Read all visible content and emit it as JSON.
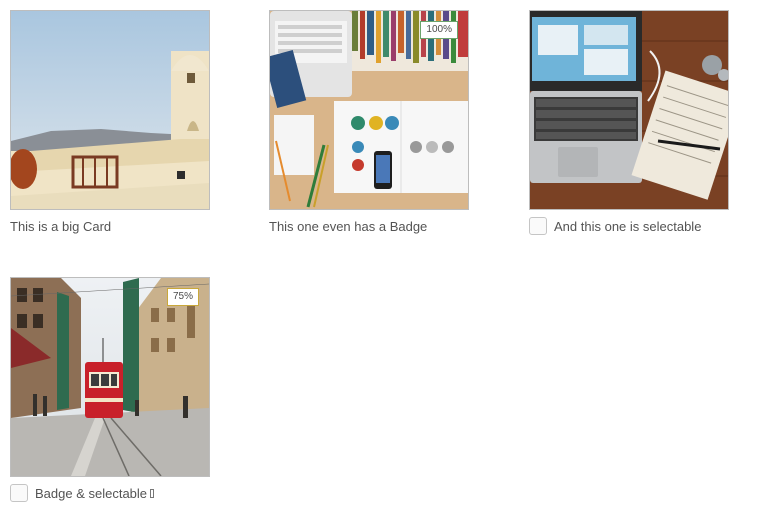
{
  "cards": [
    {
      "caption": "This is a big Card",
      "image": "santorini-terrace-photo",
      "badge": null,
      "selectable": false
    },
    {
      "caption": "This one even has a Badge",
      "image": "desk-flatlay-photo",
      "badge": "100%",
      "selectable": false
    },
    {
      "caption": "And this one is selectable",
      "image": "laptop-notebook-photo",
      "badge": null,
      "selectable": true
    },
    {
      "caption": "Badge & selectable",
      "image": "istanbul-tram-photo",
      "badge": "75%",
      "selectable": true
    }
  ],
  "colors": {
    "badge_green_border": "#6ca46c",
    "badge_gold_border": "#c9a83a",
    "caption_text": "#545454",
    "tram_red": "#c8202a"
  }
}
